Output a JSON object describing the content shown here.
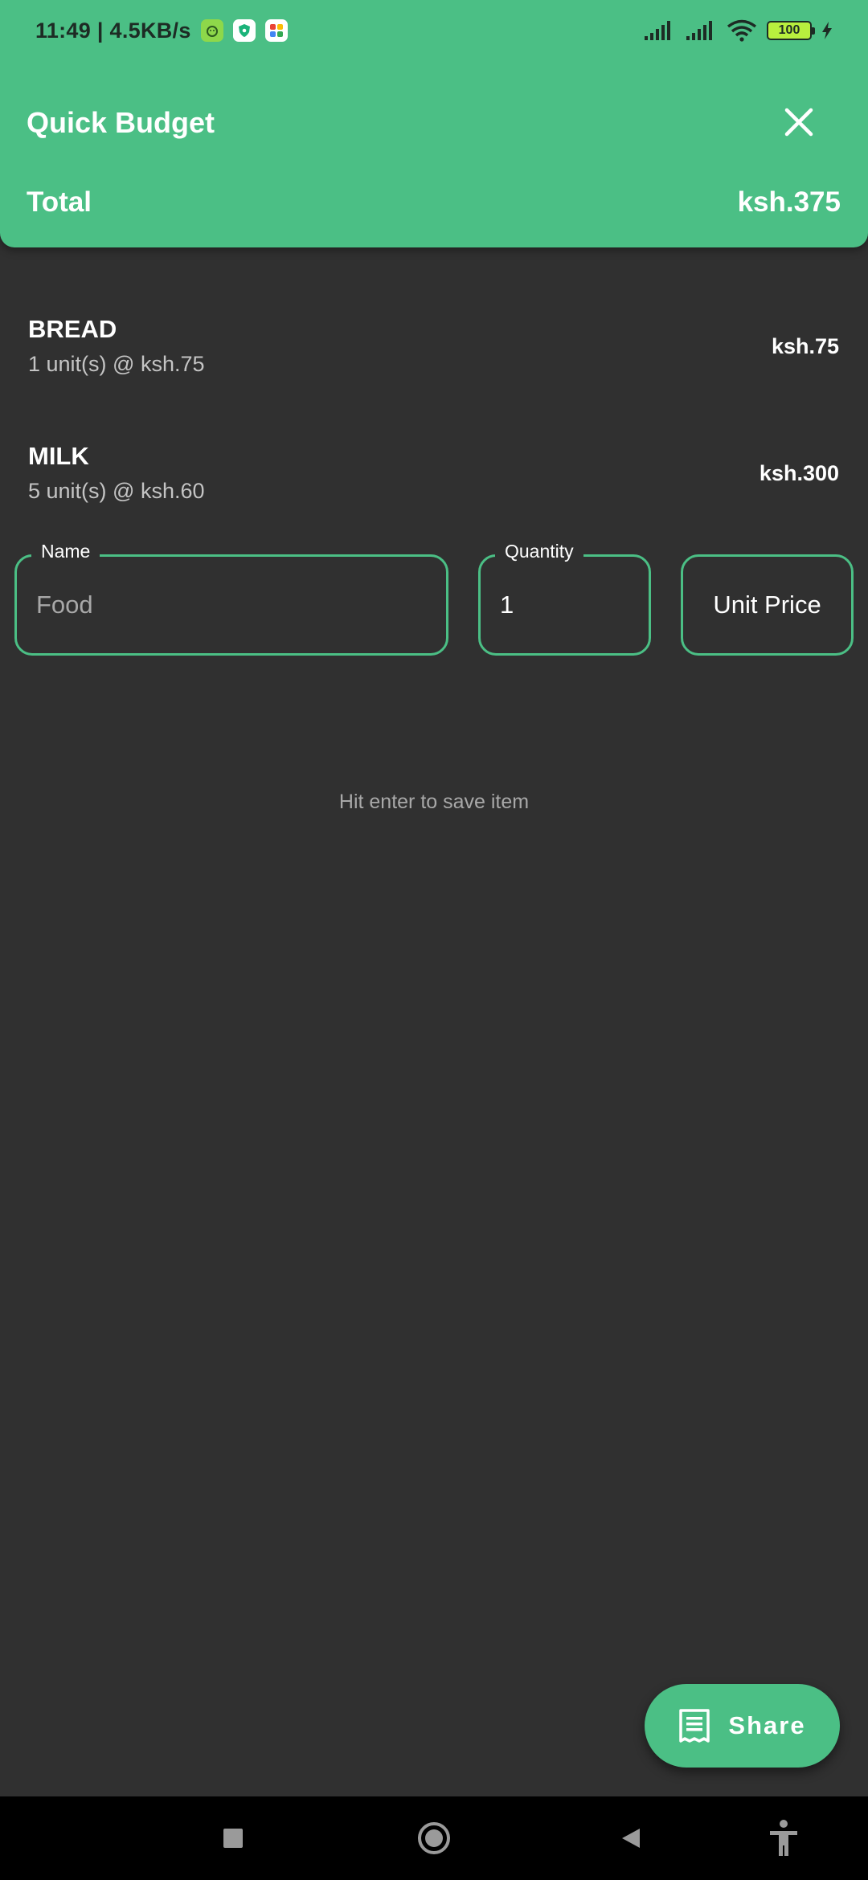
{
  "status_bar": {
    "time_speed": "11:49 | 4.5KB/s",
    "battery": "100"
  },
  "app_bar": {
    "title": "Quick Budget",
    "total_label": "Total",
    "total_value": "ksh.375"
  },
  "items": [
    {
      "name": "BREAD",
      "detail": "1 unit(s) @ ksh.75",
      "total": "ksh.75"
    },
    {
      "name": "MILK",
      "detail": "5 unit(s) @ ksh.60",
      "total": "ksh.300"
    }
  ],
  "form": {
    "name": {
      "label": "Name",
      "placeholder": "Food"
    },
    "quantity": {
      "label": "Quantity",
      "value": "1"
    },
    "unit_price": {
      "placeholder": "Unit Price"
    }
  },
  "hint": "Hit enter to save item",
  "fab": {
    "label": "Share",
    "icon": "receipt-icon"
  },
  "nav": {
    "recents": "square-icon",
    "home": "circle-icon",
    "back": "triangle-icon",
    "accessibility": "accessibility-icon"
  },
  "colors": {
    "accent": "#4bbf85",
    "background": "#303030"
  }
}
